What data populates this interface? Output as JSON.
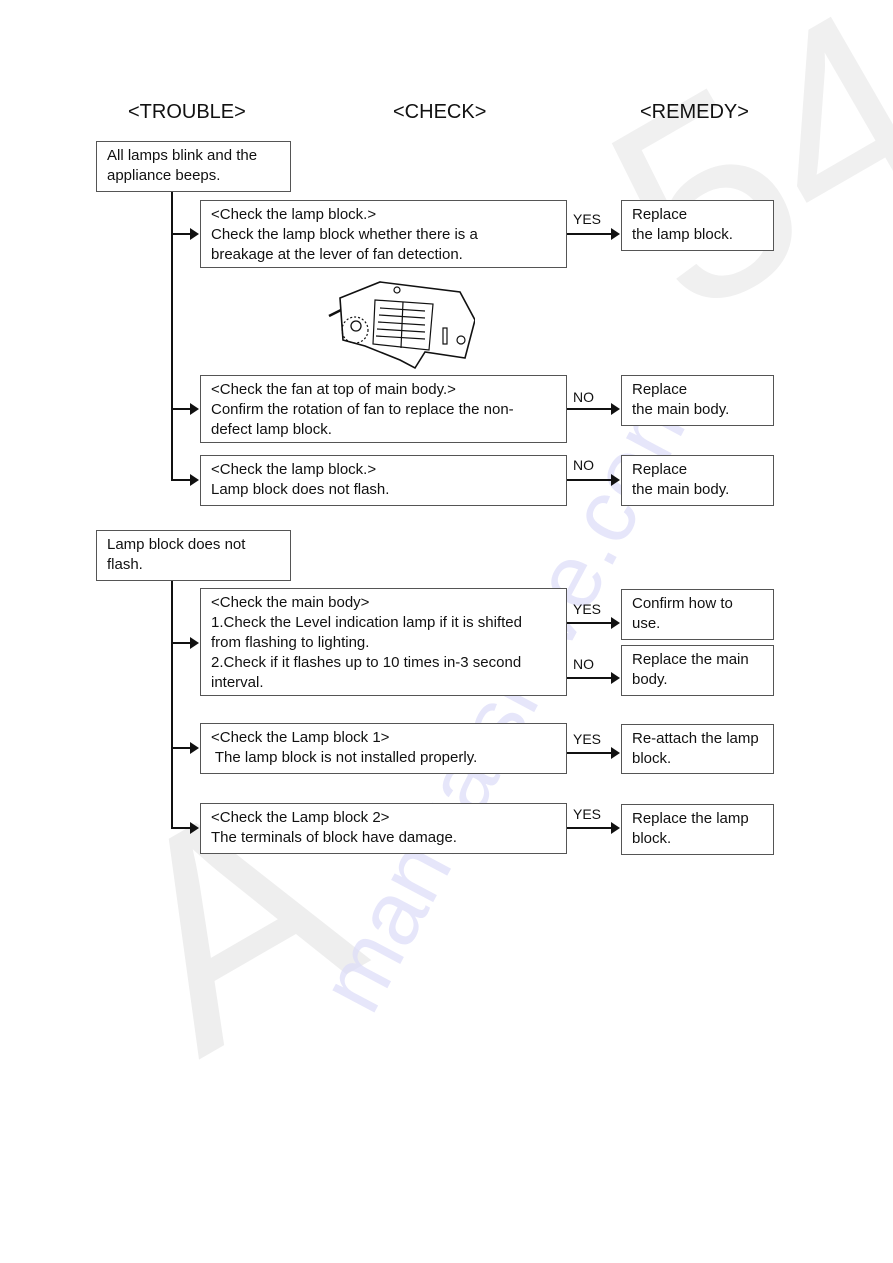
{
  "headers": {
    "trouble": "<TROUBLE>",
    "check": "<CHECK>",
    "remedy": "<REMEDY>"
  },
  "watermarks": {
    "big": "A",
    "site": "manualshive.com",
    "num": "54"
  },
  "section1": {
    "trouble": [
      "All lamps blink and the",
      "appliance beeps."
    ],
    "checks": [
      {
        "lines": [
          "<Check the lamp block.>",
          "Check the lamp block whether there is a",
          "breakage at the lever of fan detection."
        ],
        "result": "YES",
        "remedy": [
          "Replace",
          "the lamp block."
        ]
      },
      {
        "lines": [
          "<Check the fan at top of main body.>",
          "Confirm the rotation of fan to replace the non-",
          "defect lamp block."
        ],
        "result": "NO",
        "remedy": [
          "Replace",
          "the main body."
        ]
      },
      {
        "lines": [
          "<Check the lamp block.>",
          "Lamp block does not flash."
        ],
        "result": "NO",
        "remedy": [
          "Replace",
          "the main body."
        ]
      }
    ],
    "illustration": "lamp-block-illustration"
  },
  "section2": {
    "trouble": [
      "Lamp block does not",
      "flash."
    ],
    "checks": [
      {
        "lines": [
          "<Check the main body>",
          "1.Check the Level indication lamp if it is shifted",
          "from flashing to lighting.",
          "2.Check if it flashes up to 10 times in-3 second",
          "interval."
        ],
        "results": [
          {
            "label": "YES",
            "remedy": [
              "Confirm how to",
              "use."
            ]
          },
          {
            "label": "NO",
            "remedy": [
              "Replace the main",
              "body."
            ]
          }
        ]
      },
      {
        "lines": [
          "<Check the Lamp block 1>",
          " The lamp block is not installed properly."
        ],
        "result": "YES",
        "remedy": [
          "Re-attach the lamp",
          "block."
        ]
      },
      {
        "lines": [
          "<Check the Lamp block 2>",
          "The terminals of block have damage."
        ],
        "result": "YES",
        "remedy": [
          "Replace the lamp",
          "block."
        ]
      }
    ]
  }
}
